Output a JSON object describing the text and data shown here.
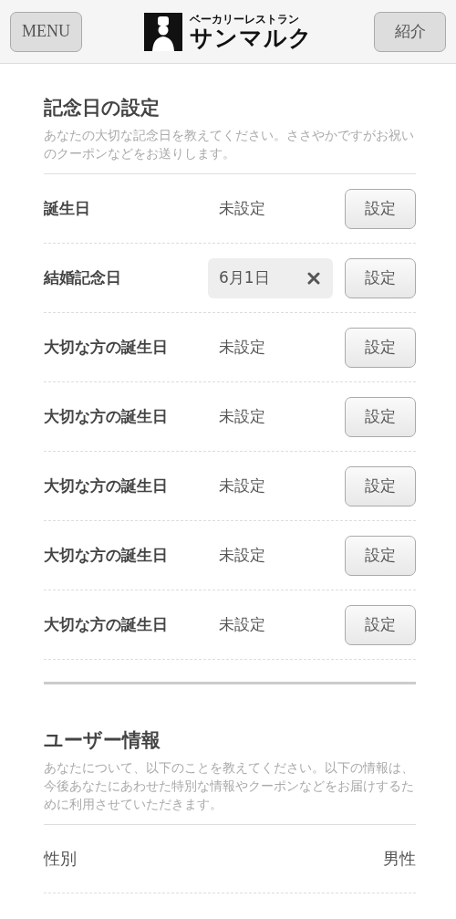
{
  "header": {
    "menu_button": "MENU",
    "logo": {
      "subtitle": "ベーカリーレストラン",
      "name": "サンマルク"
    },
    "intro_button": "紹介"
  },
  "anniversary": {
    "title": "記念日の設定",
    "description": "あなたの大切な記念日を教えてください。ささやかですがお祝いのクーポンなどをお送りします。",
    "rows": [
      {
        "label": "誕生日",
        "kind": "text",
        "value": "未設定",
        "button": "設定"
      },
      {
        "label": "結婚記念日",
        "kind": "chip",
        "value": "6月1日",
        "button": "設定"
      },
      {
        "label": "大切な方の誕生日",
        "kind": "text",
        "value": "未設定",
        "button": "設定"
      },
      {
        "label": "大切な方の誕生日",
        "kind": "text",
        "value": "未設定",
        "button": "設定"
      },
      {
        "label": "大切な方の誕生日",
        "kind": "text",
        "value": "未設定",
        "button": "設定"
      },
      {
        "label": "大切な方の誕生日",
        "kind": "text",
        "value": "未設定",
        "button": "設定"
      },
      {
        "label": "大切な方の誕生日",
        "kind": "text",
        "value": "未設定",
        "button": "設定"
      }
    ]
  },
  "user_info": {
    "title": "ユーザー情報",
    "description": "あなたについて、以下のことを教えてください。以下の情報は、今後あなたにあわせた特別な情報やクーポンなどをお届けするために利用させていただきます。",
    "rows": [
      {
        "label": "性別",
        "value": "男性"
      }
    ]
  }
}
